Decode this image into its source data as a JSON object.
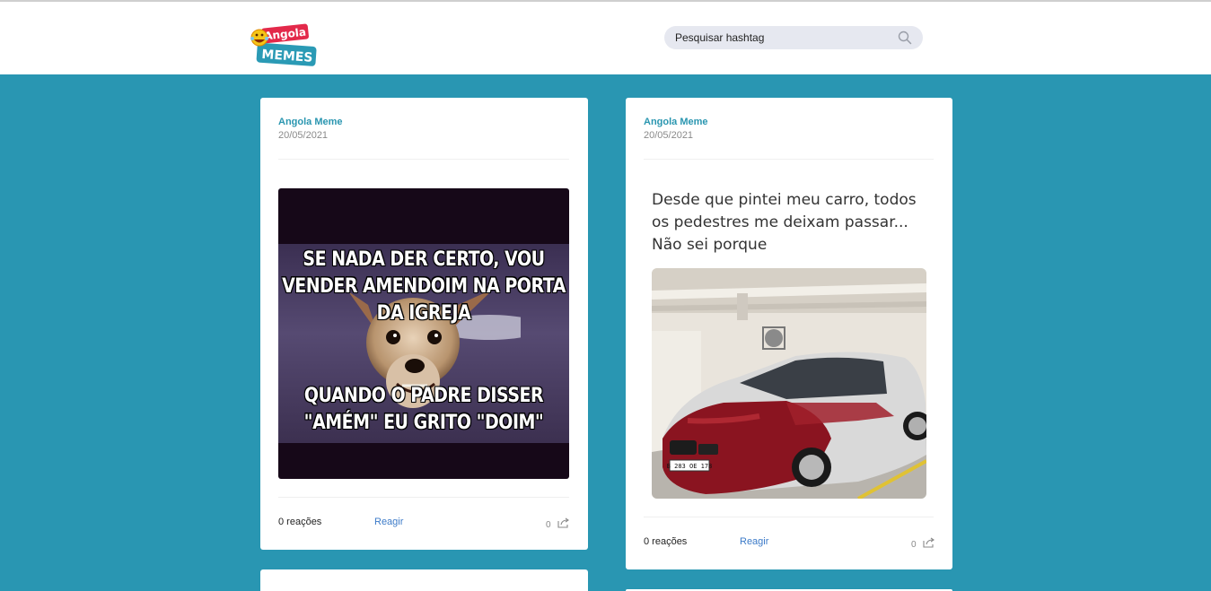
{
  "header": {
    "logo": {
      "line1": "Angola",
      "line2": "MEMES"
    },
    "search": {
      "placeholder": "Pesquisar hashtag",
      "icon": "search-icon"
    }
  },
  "posts": [
    {
      "author": "Angola Meme",
      "date": "20/05/2021",
      "meme_top_text": "SE NADA DER CERTO, VOU VENDER AMENDOIM NA PORTA DA IGREJA",
      "meme_bottom_text": "QUANDO O PADRE DISSER \"AMÉM\" EU GRITO \"DOIM\"",
      "reactions": "0 reações",
      "react_label": "Reagir",
      "share_count": "0",
      "share_icon": "share-icon"
    },
    {
      "author": "Angola Meme",
      "date": "20/05/2021",
      "caption": "Desde que pintei meu carro, todos os pedestres me deixam passar... Não sei porque",
      "plate": "В 283 ОЕ 178",
      "reactions": "0 reações",
      "react_label": "Reagir",
      "share_count": "0",
      "share_icon": "share-icon"
    }
  ],
  "colors": {
    "background": "#2996b2",
    "accent": "#2a96b0",
    "link": "#3b7ac8"
  }
}
